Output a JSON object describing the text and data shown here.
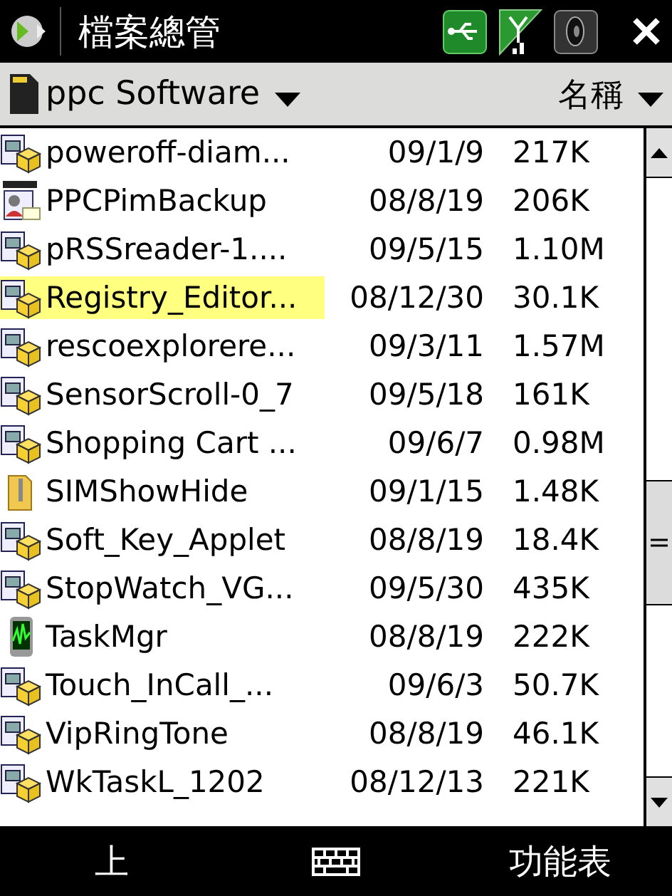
{
  "title_bar": {
    "title": "檔案總管"
  },
  "location_bar": {
    "folder": "ppc Software",
    "sort": "名稱"
  },
  "files": [
    {
      "name": "poweroff-diam...",
      "date": "09/1/9",
      "size": "217K",
      "kind": "cab",
      "selected": false
    },
    {
      "name": "PPCPimBackup",
      "date": "08/8/19",
      "size": "206K",
      "kind": "backup",
      "selected": false
    },
    {
      "name": "pRSSreader-1....",
      "date": "09/5/15",
      "size": "1.10M",
      "kind": "cab",
      "selected": false
    },
    {
      "name": "Registry_Editor...",
      "date": "08/12/30",
      "size": "30.1K",
      "kind": "cab",
      "selected": true
    },
    {
      "name": "rescoexplorere...",
      "date": "09/3/11",
      "size": "1.57M",
      "kind": "cab",
      "selected": false
    },
    {
      "name": "SensorScroll-0_7",
      "date": "09/5/18",
      "size": "161K",
      "kind": "cab",
      "selected": false
    },
    {
      "name": "Shopping Cart ...",
      "date": "09/6/7",
      "size": "0.98M",
      "kind": "cab",
      "selected": false
    },
    {
      "name": "SIMShowHide",
      "date": "09/1/15",
      "size": "1.48K",
      "kind": "zip",
      "selected": false
    },
    {
      "name": "Soft_Key_Applet",
      "date": "08/8/19",
      "size": "18.4K",
      "kind": "cab",
      "selected": false
    },
    {
      "name": "StopWatch_VG...",
      "date": "09/5/30",
      "size": "435K",
      "kind": "cab",
      "selected": false
    },
    {
      "name": "TaskMgr",
      "date": "08/8/19",
      "size": "222K",
      "kind": "monitor",
      "selected": false
    },
    {
      "name": "Touch_InCall_...",
      "date": "09/6/3",
      "size": "50.7K",
      "kind": "cab",
      "selected": false
    },
    {
      "name": "VipRingTone",
      "date": "08/8/19",
      "size": "46.1K",
      "kind": "cab",
      "selected": false
    },
    {
      "name": "WkTaskL_1202",
      "date": "08/12/13",
      "size": "221K",
      "kind": "cab",
      "selected": false
    }
  ],
  "soft_keys": {
    "left": "上",
    "right": "功能表"
  }
}
